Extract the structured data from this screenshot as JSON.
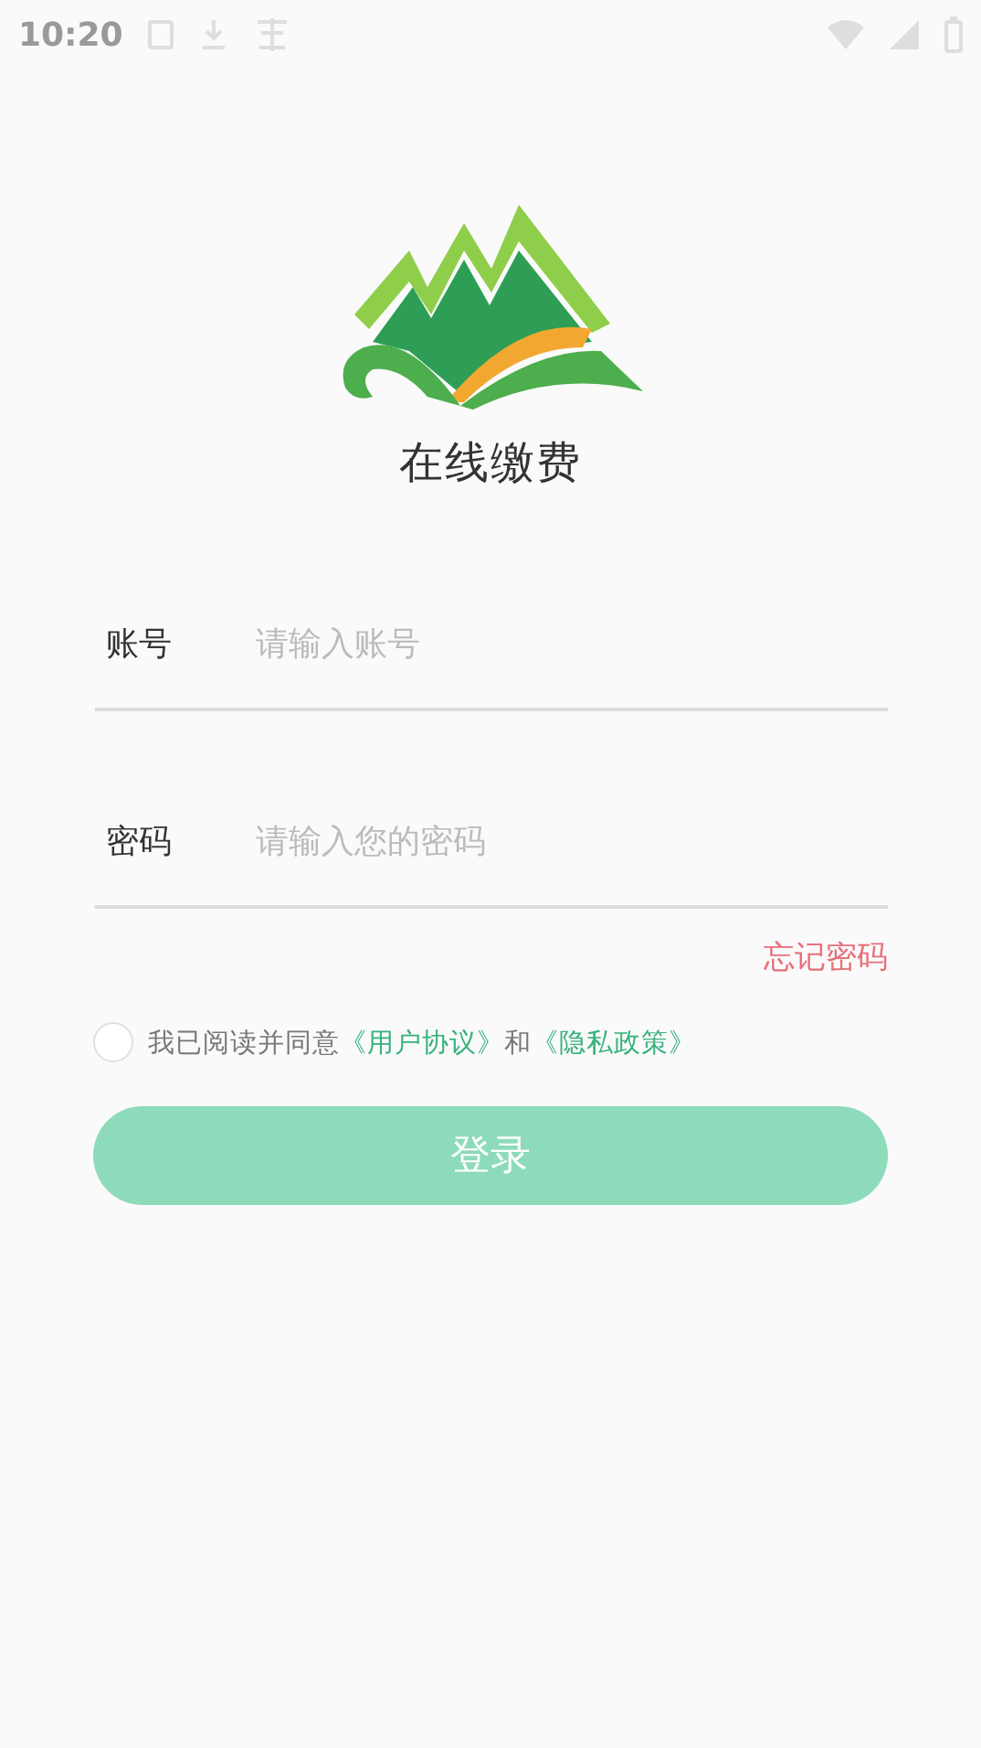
{
  "status_bar": {
    "time": "10:20"
  },
  "app": {
    "title": "在线缴费"
  },
  "fields": [
    {
      "label": "账号",
      "placeholder": "请输入账号"
    },
    {
      "label": "密码",
      "placeholder": "请输入您的密码"
    }
  ],
  "forgot_link": "忘记密码",
  "agreement": {
    "checked": false,
    "parts": [
      {
        "kind": "text",
        "text": "我已阅读并同意"
      },
      {
        "kind": "link",
        "text": "《用户协议》"
      },
      {
        "kind": "text",
        "text": "和"
      },
      {
        "kind": "link",
        "text": "《隐私政策》"
      }
    ]
  },
  "login_button": {
    "label": "登录",
    "disabled": true
  }
}
